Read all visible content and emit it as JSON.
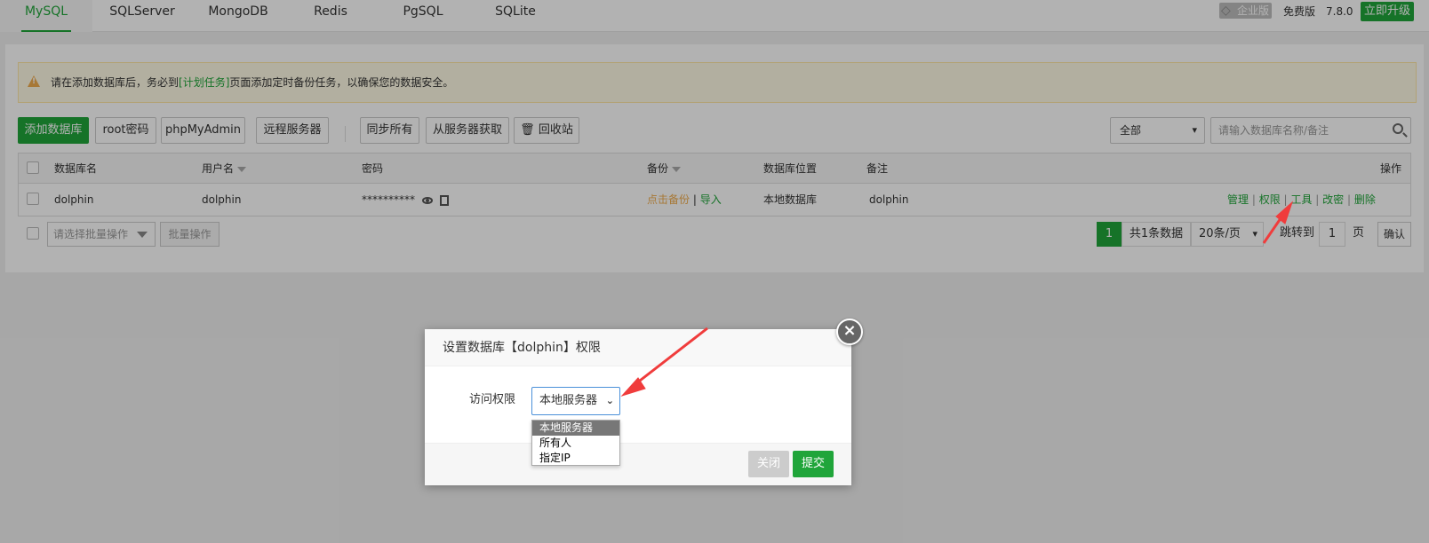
{
  "tabs": [
    {
      "label": "MySQL",
      "active": true
    },
    {
      "label": "SQLServer"
    },
    {
      "label": "MongoDB"
    },
    {
      "label": "Redis"
    },
    {
      "label": "PgSQL"
    },
    {
      "label": "SQLite"
    }
  ],
  "version_info": {
    "enterprise": "企业版",
    "free": "免费版",
    "version": "7.8.0",
    "upgrade": "立即升级"
  },
  "notice": {
    "prefix": "请在添加数据库后，务必到",
    "link": "[计划任务]",
    "suffix": "页面添加定时备份任务，以确保您的数据安全。"
  },
  "toolbar": {
    "add_db": "添加数据库",
    "root_pwd": "root密码",
    "phpmyadmin": "phpMyAdmin",
    "remote_server": "远程服务器",
    "sync_all": "同步所有",
    "fetch_from_server": "从服务器获取",
    "recycle": "回收站",
    "filter_value": "全部",
    "search_placeholder": "请输入数据库名称/备注"
  },
  "table": {
    "headers": {
      "name": "数据库名",
      "user": "用户名",
      "password": "密码",
      "backup": "备份",
      "location": "数据库位置",
      "remark": "备注",
      "ops": "操作"
    },
    "rows": [
      {
        "name": "dolphin",
        "user": "dolphin",
        "password": "**********",
        "backup": "点击备份",
        "import": "导入",
        "location": "本地数据库",
        "remark": "dolphin",
        "ops": [
          "管理",
          "权限",
          "工具",
          "改密",
          "删除"
        ]
      }
    ]
  },
  "batch": {
    "select_placeholder": "请选择批量操作",
    "button": "批量操作"
  },
  "pager": {
    "current": "1",
    "total": "共1条数据",
    "page_size": "20条/页",
    "jump_label": "跳转到",
    "jump_value": "1",
    "unit": "页",
    "confirm": "确认"
  },
  "dialog": {
    "title": "设置数据库【dolphin】权限",
    "label": "访问权限",
    "selected": "本地服务器",
    "options": [
      "本地服务器",
      "所有人",
      "指定IP"
    ],
    "close": "关闭",
    "submit": "提交"
  },
  "colors": {
    "brand": "#20a53a",
    "warn": "#f0ad4e",
    "annotation_arrow": "#f03c3c"
  }
}
